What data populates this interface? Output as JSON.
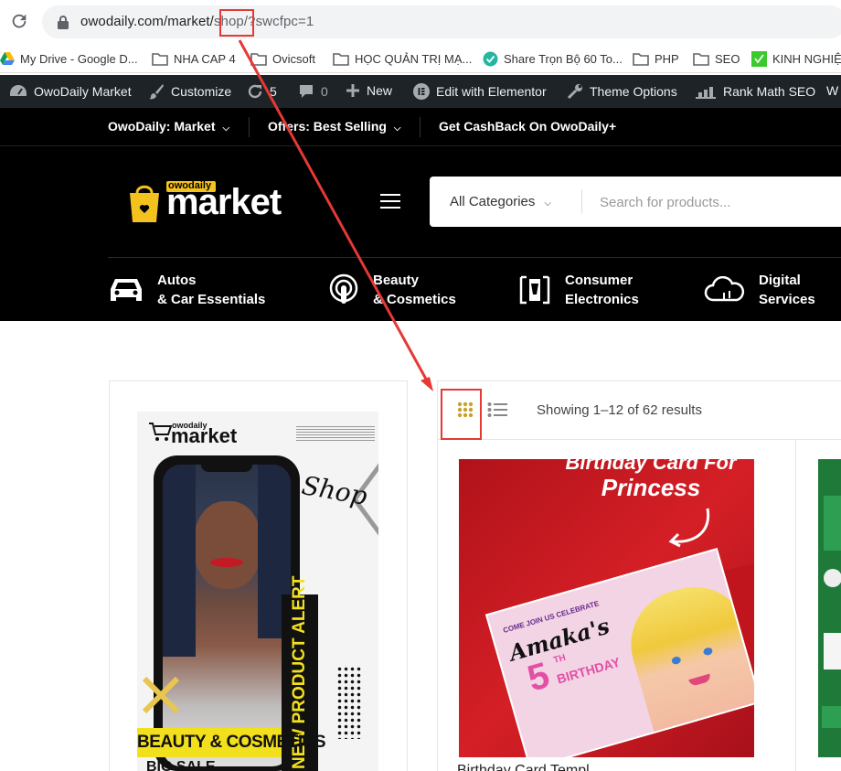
{
  "browser": {
    "url_host": "owodaily.com/market/",
    "url_highlight": "shop",
    "url_rest": "/?swcfpc=1",
    "bookmarks": [
      {
        "label": "My Drive - Google D...",
        "icon": "google-drive-icon"
      },
      {
        "label": "NHA CAP 4",
        "icon": "folder-icon"
      },
      {
        "label": "Ovicsoft",
        "icon": "folder-icon"
      },
      {
        "label": "HỌC QUẢN TRỊ MẠ...",
        "icon": "folder-icon"
      },
      {
        "label": "Share Trọn Bộ 60 To...",
        "icon": "check-circle-icon"
      },
      {
        "label": "PHP",
        "icon": "folder-icon"
      },
      {
        "label": "SEO",
        "icon": "folder-icon"
      },
      {
        "label": "KINH NGHIỆ",
        "icon": "green-square-icon"
      }
    ]
  },
  "admin_bar": {
    "site": "OwoDaily Market",
    "customize": "Customize",
    "updates": "5",
    "comments": "0",
    "new": "New",
    "elementor": "Edit with Elementor",
    "theme_options": "Theme Options",
    "rank_math": "Rank Math SEO",
    "overflow": "W"
  },
  "top_nav": [
    {
      "label": "OwoDaily: Market",
      "dropdown": true
    },
    {
      "label": "Offers: Best Selling",
      "dropdown": true
    },
    {
      "label": "Get CashBack On OwoDaily+",
      "dropdown": false
    }
  ],
  "header": {
    "logo_small": "owodaily",
    "logo_big": "market",
    "category_select": "All Categories",
    "search_placeholder": "Search for products..."
  },
  "categories": [
    {
      "line1": "Autos",
      "line2": "& Car Essentials",
      "icon": "car-icon"
    },
    {
      "line1": "Beauty",
      "line2": "& Cosmetics",
      "icon": "podcast-icon"
    },
    {
      "line1": "Consumer",
      "line2": "Electronics",
      "icon": "phone-case-icon"
    },
    {
      "line1": "Digital",
      "line2": "Services",
      "icon": "cloud-icon"
    }
  ],
  "shop": {
    "result_count": "Showing 1–12 of 62 results",
    "banner": {
      "brand_small": "owodaily",
      "brand_big": "market",
      "script": "Shop",
      "tag": "NEW PRODUCT ALERT",
      "caption": "BEAUTY & COSMETICS",
      "sale": "BIG SALE"
    },
    "product1": {
      "headline1": "Birthday Card For",
      "headline2": "Princess",
      "card_line1": "COME JOIN US CELEBRATE",
      "card_name": "Amaka's",
      "card_age": "5",
      "card_th": "TH",
      "card_word": "BIRTHDAY",
      "title": "Birthday Card Templ..."
    }
  },
  "colors": {
    "accent": "#c9a227",
    "annotation": "#e53935",
    "wp_bar": "#1d2327"
  }
}
